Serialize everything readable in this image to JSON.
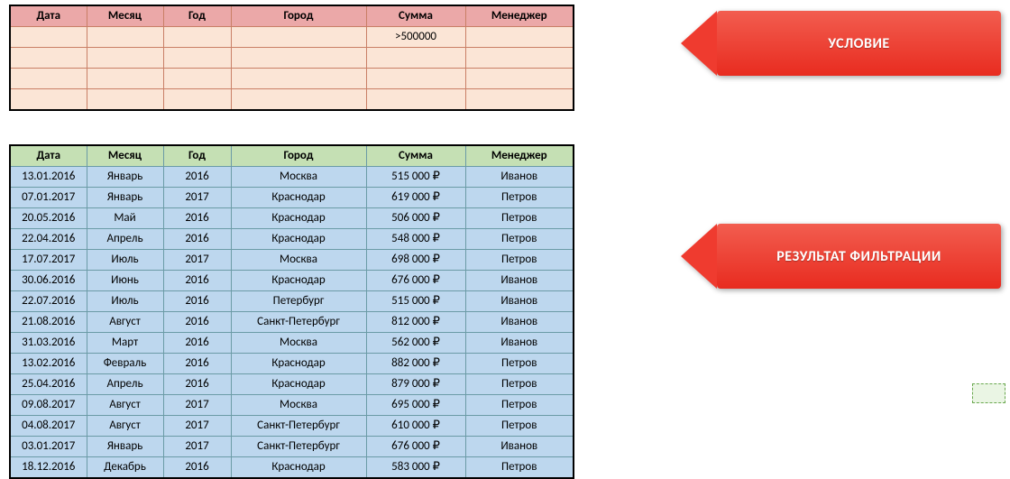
{
  "headers": [
    "Дата",
    "Месяц",
    "Год",
    "Город",
    "Сумма",
    "Менеджер"
  ],
  "criteria_rows": [
    [
      "",
      "",
      "",
      "",
      ">500000",
      ""
    ],
    [
      "",
      "",
      "",
      "",
      "",
      ""
    ],
    [
      "",
      "",
      "",
      "",
      "",
      ""
    ],
    [
      "",
      "",
      "",
      "",
      "",
      ""
    ]
  ],
  "result_rows": [
    [
      "13.01.2016",
      "Январь",
      "2016",
      "Москва",
      "515 000 ₽",
      "Иванов"
    ],
    [
      "07.01.2017",
      "Январь",
      "2017",
      "Краснодар",
      "619 000 ₽",
      "Петров"
    ],
    [
      "20.05.2016",
      "Май",
      "2016",
      "Краснодар",
      "506 000 ₽",
      "Петров"
    ],
    [
      "22.04.2016",
      "Апрель",
      "2016",
      "Краснодар",
      "548 000 ₽",
      "Петров"
    ],
    [
      "17.07.2017",
      "Июль",
      "2017",
      "Москва",
      "698 000 ₽",
      "Петров"
    ],
    [
      "30.06.2016",
      "Июнь",
      "2016",
      "Краснодар",
      "676 000 ₽",
      "Иванов"
    ],
    [
      "22.07.2016",
      "Июль",
      "2016",
      "Петербург",
      "515 000 ₽",
      "Иванов"
    ],
    [
      "21.08.2016",
      "Август",
      "2016",
      "Санкт-Петербург",
      "812 000 ₽",
      "Иванов"
    ],
    [
      "31.03.2016",
      "Март",
      "2016",
      "Москва",
      "562 000 ₽",
      "Иванов"
    ],
    [
      "13.02.2016",
      "Февраль",
      "2016",
      "Краснодар",
      "882 000 ₽",
      "Петров"
    ],
    [
      "25.04.2016",
      "Апрель",
      "2016",
      "Краснодар",
      "879 000 ₽",
      "Петров"
    ],
    [
      "09.08.2017",
      "Август",
      "2017",
      "Москва",
      "695 000 ₽",
      "Петров"
    ],
    [
      "04.08.2017",
      "Август",
      "2017",
      "Санкт-Петербург",
      "610 000 ₽",
      "Петров"
    ],
    [
      "03.01.2017",
      "Январь",
      "2017",
      "Санкт-Петербург",
      "676 000 ₽",
      "Иванов"
    ],
    [
      "18.12.2016",
      "Декабрь",
      "2016",
      "Краснодар",
      "583 000 ₽",
      "Петров"
    ]
  ],
  "callouts": {
    "condition": "УСЛОВИЕ",
    "result": "РЕЗУЛЬТАТ ФИЛЬТРАЦИИ"
  }
}
